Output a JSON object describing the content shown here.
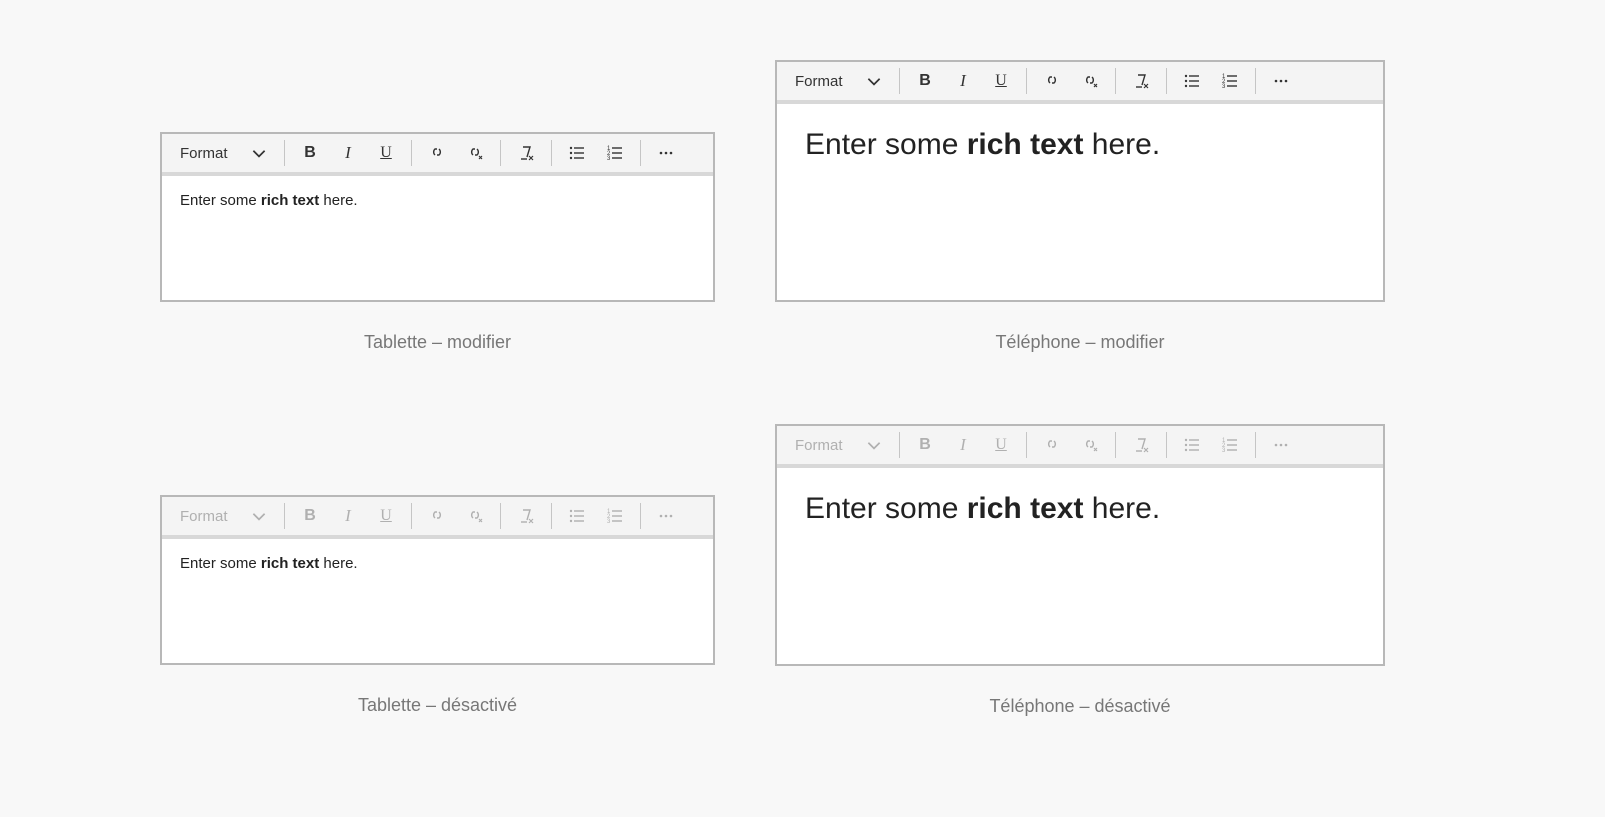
{
  "editors": {
    "tablet_edit": {
      "caption": "Tablette – modifier",
      "format_label": "Format",
      "disabled": false,
      "large": false
    },
    "phone_edit": {
      "caption": "Téléphone – modifier",
      "format_label": "Format",
      "disabled": false,
      "large": true
    },
    "tablet_disabled": {
      "caption": "Tablette – désactivé",
      "format_label": "Format",
      "disabled": true,
      "large": false
    },
    "phone_disabled": {
      "caption": "Téléphone – désactivé",
      "format_label": "Format",
      "disabled": true,
      "large": true
    }
  },
  "sample": {
    "pre": "Enter some ",
    "bold": "rich text",
    "post": " here."
  },
  "toolbar_buttons": [
    {
      "name": "bold-button",
      "icon": "bold"
    },
    {
      "name": "italic-button",
      "icon": "italic"
    },
    {
      "name": "underline-button",
      "icon": "underline"
    },
    {
      "name": "insert-link-button",
      "icon": "link"
    },
    {
      "name": "remove-link-button",
      "icon": "unlink"
    },
    {
      "name": "clear-format-button",
      "icon": "clear-format"
    },
    {
      "name": "bulleted-list-button",
      "icon": "ul"
    },
    {
      "name": "numbered-list-button",
      "icon": "ol"
    },
    {
      "name": "more-button",
      "icon": "more"
    }
  ]
}
